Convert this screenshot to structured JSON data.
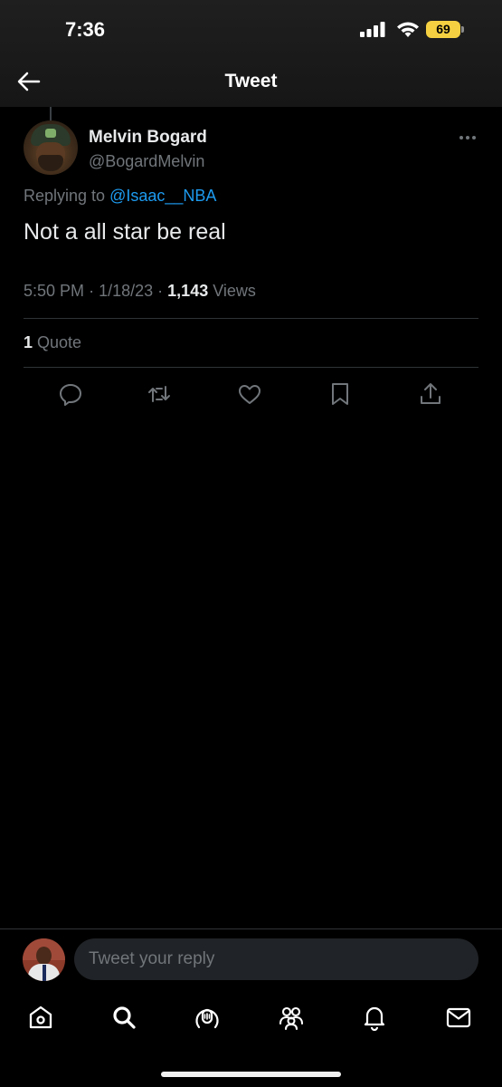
{
  "status_bar": {
    "time": "7:36",
    "battery": "69",
    "battery_color": "#f5d142",
    "icons": [
      "signal-icon",
      "wifi-icon",
      "battery-icon"
    ]
  },
  "header": {
    "title": "Tweet",
    "back_icon": "arrow-left-icon"
  },
  "tweet": {
    "display_name": "Melvin Bogard",
    "username": "@BogardMelvin",
    "replying_prefix": "Replying to",
    "replying_to": "@Isaac__NBA",
    "text": "Not a all star be real",
    "time": "5:50 PM",
    "separator": "·",
    "date": "1/18/23",
    "views_count": "1,143",
    "views_label": "Views",
    "quote_count": "1",
    "quote_label": "Quote",
    "more_icon": "more-horizontal-icon"
  },
  "actions": [
    "reply-icon",
    "retweet-icon",
    "like-icon",
    "bookmark-icon",
    "share-icon"
  ],
  "reply_bar": {
    "placeholder": "Tweet your reply"
  },
  "bottom_nav": [
    "home-icon",
    "search-icon",
    "spaces-icon",
    "communities-icon",
    "notifications-icon",
    "messages-icon"
  ],
  "colors": {
    "background": "#000000",
    "text_primary": "#e7e9ea",
    "text_secondary": "#71767b",
    "accent": "#1d9bf0",
    "divider": "#2f3336"
  }
}
